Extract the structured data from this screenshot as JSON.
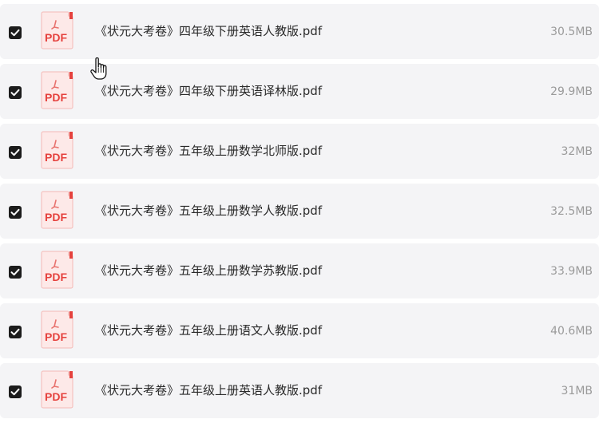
{
  "files": [
    {
      "name": "《状元大考卷》四年级下册英语人教版.pdf",
      "size": "30.5MB",
      "checked": true,
      "icon": "pdf-icon"
    },
    {
      "name": "《状元大考卷》四年级下册英语译林版.pdf",
      "size": "29.9MB",
      "checked": true,
      "icon": "pdf-icon"
    },
    {
      "name": "《状元大考卷》五年级上册数学北师版.pdf",
      "size": "32MB",
      "checked": true,
      "icon": "pdf-icon"
    },
    {
      "name": "《状元大考卷》五年级上册数学人教版.pdf",
      "size": "32.5MB",
      "checked": true,
      "icon": "pdf-icon"
    },
    {
      "name": "《状元大考卷》五年级上册数学苏教版.pdf",
      "size": "33.9MB",
      "checked": true,
      "icon": "pdf-icon"
    },
    {
      "name": "《状元大考卷》五年级上册语文人教版.pdf",
      "size": "40.6MB",
      "checked": true,
      "icon": "pdf-icon"
    },
    {
      "name": "《状元大考卷》五年级上册英语人教版.pdf",
      "size": "31MB",
      "checked": true,
      "icon": "pdf-icon"
    }
  ],
  "pdf_icon_label": "PDF",
  "colors": {
    "row_background": "#f4f4f6",
    "checkbox": "#1c1c1c",
    "pdf_red": "#e5413d",
    "size_text": "#9a9a9a"
  }
}
